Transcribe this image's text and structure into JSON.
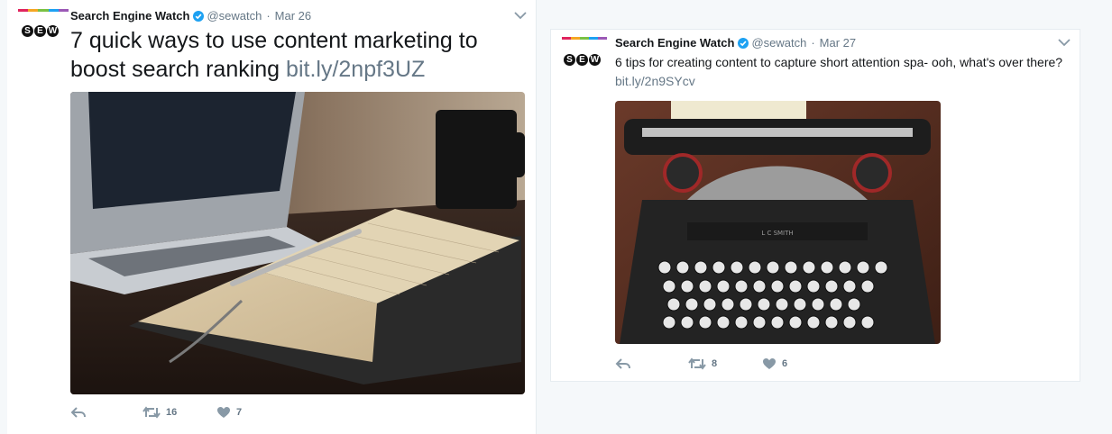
{
  "tweets": [
    {
      "account_name": "Search Engine Watch",
      "handle": "@sewatch",
      "separator": "·",
      "date": "Mar 26",
      "text": "7 quick ways to use content marketing to boost search ranking",
      "link": "bit.ly/2npf3UZ",
      "avatar_letters": [
        "S",
        "E",
        "W"
      ],
      "retweet_count": "16",
      "like_count": "7"
    },
    {
      "account_name": "Search Engine Watch",
      "handle": "@sewatch",
      "separator": "·",
      "date": "Mar 27",
      "text": "6 tips for creating content to capture short attention spa- ooh, what's over there?",
      "link": "bit.ly/2n9SYcv",
      "avatar_letters": [
        "S",
        "E",
        "W"
      ],
      "retweet_count": "8",
      "like_count": "6"
    }
  ],
  "icons": {
    "verified": "verified-badge-icon",
    "reply": "reply-icon",
    "retweet": "retweet-icon",
    "like": "heart-icon",
    "more": "chevron-down-icon"
  },
  "colors": {
    "verified": "#1da1f2",
    "meta_text": "#657786",
    "body_text": "#14171a",
    "avatar_stripes": [
      "#e0245e",
      "#f5a623",
      "#7ac143",
      "#1da1f2",
      "#9b59b6"
    ]
  }
}
